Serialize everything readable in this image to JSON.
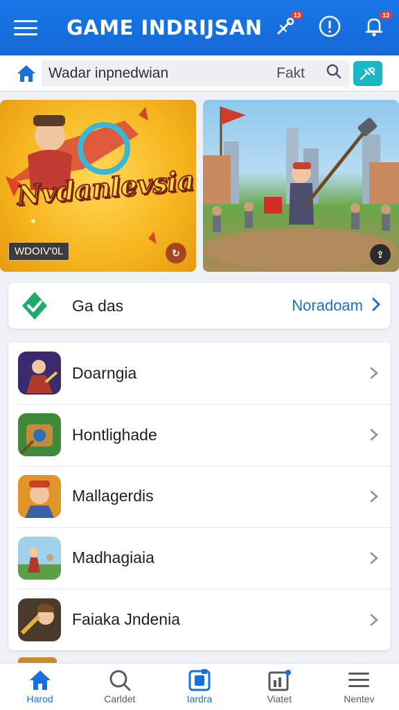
{
  "header": {
    "title": "GAME INDRIJSAN",
    "badges": {
      "tools": "13",
      "notifications": "13"
    },
    "icons": [
      "menu-icon",
      "tools-icon",
      "alert-icon",
      "notification-bell-icon"
    ]
  },
  "search": {
    "query": "Wadar inpnedwian",
    "filter_label": "Fakt"
  },
  "banners": [
    {
      "title": "Nvdanlevsia",
      "tag": "WDOIV'0L",
      "action_icon": "refresh-icon"
    },
    {
      "title": "",
      "action_icon": "share-icon"
    }
  ],
  "category": {
    "label": "Ga das",
    "link": "Noradoam"
  },
  "games": [
    {
      "name": "Doarngia"
    },
    {
      "name": "Hontlighade"
    },
    {
      "name": "Mallagerdis"
    },
    {
      "name": "Madhagiaia"
    },
    {
      "name": "Faiaka Jndenia"
    }
  ],
  "nav": [
    {
      "label": "Harod",
      "icon": "home-icon",
      "active": true
    },
    {
      "label": "Carldet",
      "icon": "search-icon",
      "active": false
    },
    {
      "label": "Iardra",
      "icon": "library-icon",
      "active": true
    },
    {
      "label": "Viatet",
      "icon": "stats-icon",
      "active": false
    },
    {
      "label": "Nentev",
      "icon": "menu-icon",
      "active": false
    }
  ],
  "colors": {
    "primary": "#1670e0",
    "accent_teal": "#1ab6c4",
    "link_blue": "#1a6fcc",
    "badge_red": "#e53935"
  }
}
